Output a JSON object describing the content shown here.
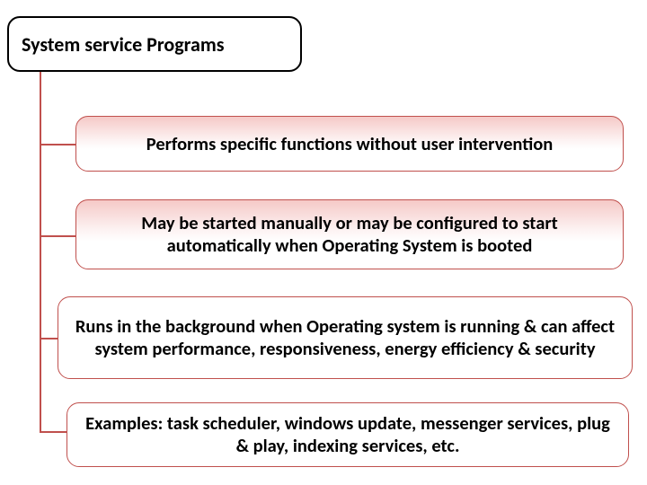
{
  "header": {
    "title": "System service Programs"
  },
  "items": [
    {
      "text": "Performs specific functions without user intervention"
    },
    {
      "text": "May be started manually or may be configured to start automatically when Operating System is booted"
    },
    {
      "text": "Runs in the background when Operating system is running & can affect system performance, responsiveness, energy efficiency & security"
    },
    {
      "text": "Examples: task scheduler, windows update, messenger services, plug & play, indexing services, etc."
    }
  ]
}
